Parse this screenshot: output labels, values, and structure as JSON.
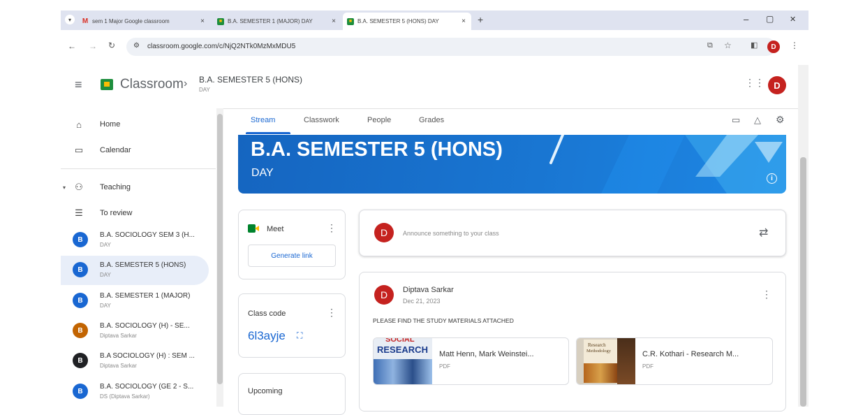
{
  "browser": {
    "tabs": [
      {
        "label": "sem 1 Major Google classroom",
        "icon": "gmail-icon",
        "close": "×"
      },
      {
        "label": "B.A. SEMESTER 1 (MAJOR) DAY",
        "icon": "classroom-icon",
        "close": "×"
      },
      {
        "label": "B.A. SEMESTER 5 (HONS) DAY",
        "icon": "classroom-icon",
        "close": "×"
      }
    ],
    "new_tab": "+",
    "url": "classroom.google.com/c/NjQ2NTk0MzMxMDU5",
    "profile_initial": "D",
    "window_minimize": "–",
    "window_restore": "▢",
    "window_close": "✕"
  },
  "header": {
    "app_name": "Classroom",
    "breadcrumb_title": "B.A. SEMESTER 5 (HONS)",
    "breadcrumb_sub": "DAY",
    "avatar_initial": "D"
  },
  "sidebar": {
    "nav": [
      {
        "label": "Home",
        "icon": "home-icon"
      },
      {
        "label": "Calendar",
        "icon": "calendar-icon"
      },
      {
        "label": "Teaching",
        "icon": "teaching-icon"
      },
      {
        "label": "To review",
        "icon": "to-review-icon"
      }
    ],
    "classes": [
      {
        "initial": "B",
        "title": "B.A. SOCIOLOGY SEM 3 (H...",
        "sub": "DAY",
        "color": "#1967d2"
      },
      {
        "initial": "B",
        "title": "B.A. SEMESTER 5 (HONS)",
        "sub": "DAY",
        "color": "#1967d2"
      },
      {
        "initial": "B",
        "title": "B.A. SEMESTER 1 (MAJOR)",
        "sub": "DAY",
        "color": "#1967d2"
      },
      {
        "initial": "B",
        "title": "B.A. SOCIOLOGY (H) - SE...",
        "sub": "Diptava Sarkar",
        "color": "#c26401"
      },
      {
        "initial": "B",
        "title": "B.A SOCIOLOGY (H) : SEM ...",
        "sub": "Diptava Sarkar",
        "color": "#202124"
      },
      {
        "initial": "B",
        "title": "B.A. SOCIOLOGY (GE 2 - S...",
        "sub": "DS (Diptava Sarkar)",
        "color": "#1967d2"
      }
    ]
  },
  "main": {
    "tabs": [
      "Stream",
      "Classwork",
      "People",
      "Grades"
    ],
    "banner": {
      "title": "B.A. SEMESTER 5 (HONS)",
      "subtitle": "DAY"
    },
    "meet": {
      "label": "Meet",
      "button": "Generate link"
    },
    "class_code": {
      "label": "Class code",
      "code": "6l3ayje"
    },
    "upcoming": {
      "label": "Upcoming"
    },
    "announce": {
      "avatar": "D",
      "placeholder": "Announce something to your class"
    },
    "post": {
      "avatar": "D",
      "author": "Diptava Sarkar",
      "date": "Dec 21, 2023",
      "body": "PLEASE FIND THE STUDY MATERIALS ATTACHED",
      "attachments": [
        {
          "title": "Matt Henn, Mark Weinstei...",
          "type": "PDF",
          "thumb_line1": "SOCIAL",
          "thumb_line2": "RESEARCH"
        },
        {
          "title": "C.R. Kothari - Research M...",
          "type": "PDF",
          "thumb_line1": "Research",
          "thumb_line2": "Methodology"
        }
      ]
    }
  },
  "colors": {
    "accent": "#1967d2",
    "avatar_red": "#c5221f",
    "banner": "#1976d2"
  }
}
